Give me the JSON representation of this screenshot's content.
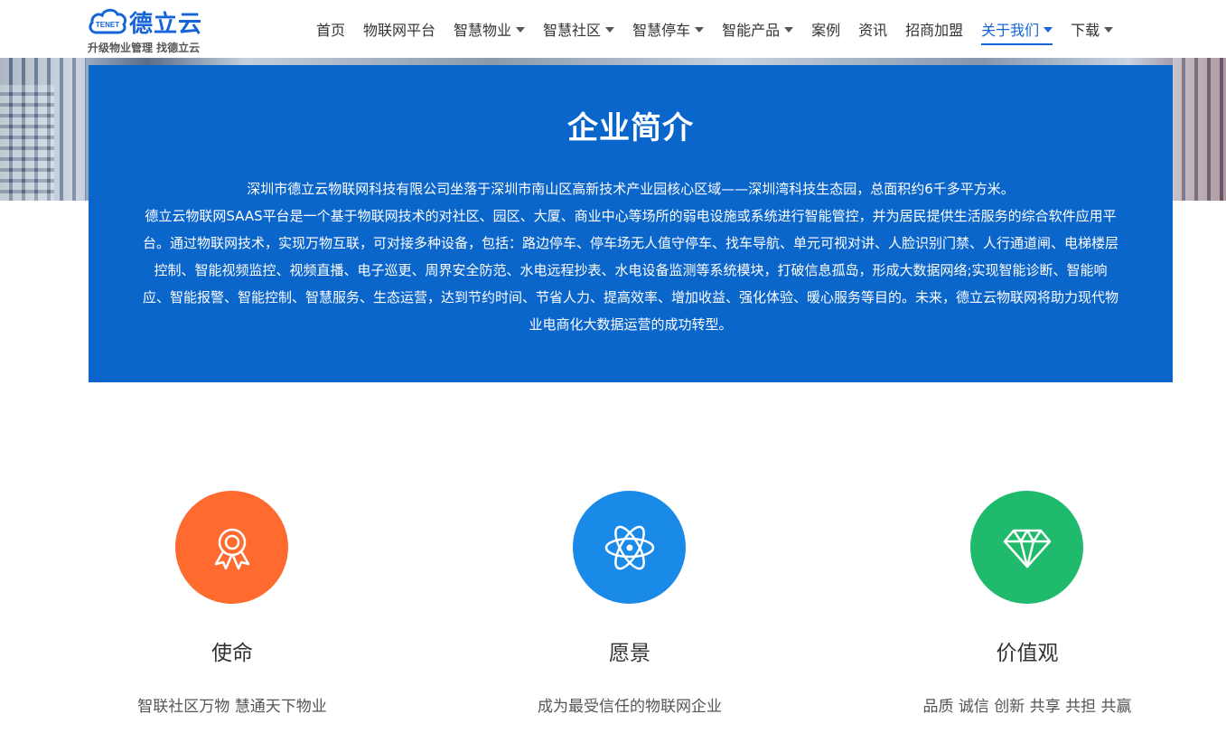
{
  "brand": {
    "name": "德立云",
    "mark_text": "TENET",
    "slogan": "升级物业管理 找德立云",
    "color": "#1565d8"
  },
  "nav": {
    "items": [
      {
        "label": "首页",
        "has_dropdown": false
      },
      {
        "label": "物联网平台",
        "has_dropdown": false
      },
      {
        "label": "智慧物业",
        "has_dropdown": true
      },
      {
        "label": "智慧社区",
        "has_dropdown": true
      },
      {
        "label": "智慧停车",
        "has_dropdown": true
      },
      {
        "label": "智能产品",
        "has_dropdown": true
      },
      {
        "label": "案例",
        "has_dropdown": false
      },
      {
        "label": "资讯",
        "has_dropdown": false
      },
      {
        "label": "招商加盟",
        "has_dropdown": false
      },
      {
        "label": "关于我们",
        "has_dropdown": true,
        "active": true
      },
      {
        "label": "下载",
        "has_dropdown": true
      }
    ]
  },
  "intro": {
    "title": "企业简介",
    "paragraph1": "深圳市德立云物联网科技有限公司坐落于深圳市南山区高新技术产业园核心区域——深圳湾科技生态园，总面积约6千多平方米。",
    "paragraph2": "德立云物联网SAAS平台是一个基于物联网技术的对社区、园区、大厦、商业中心等场所的弱电设施或系统进行智能管控，并为居民提供生活服务的综合软件应用平台。通过物联网技术，实现万物互联，可对接多种设备，包括：路边停车、停车场无人值守停车、找车导航、单元可视对讲、人脸识别门禁、人行通道闸、电梯楼层控制、智能视频监控、视频直播、电子巡更、周界安全防范、水电远程抄表、水电设备监测等系统模块，打破信息孤岛，形成大数据网络;实现智能诊断、智能响应、智能报警、智能控制、智慧服务、生态运营，达到节约时间、节省人力、提高效率、增加收益、强化体验、暖心服务等目的。未来，德立云物联网将助力现代物业电商化大数据运营的成功转型。",
    "bg_color": "#0b66cc"
  },
  "values": [
    {
      "title": "使命",
      "desc": "智联社区万物 慧通天下物业",
      "icon": "award-medal-icon",
      "color": "#ff6a2f"
    },
    {
      "title": "愿景",
      "desc": "成为最受信任的物联网企业",
      "icon": "atom-icon",
      "color": "#1a8ae8"
    },
    {
      "title": "价值观",
      "desc": "品质 诚信 创新 共享 共担 共赢",
      "icon": "diamond-icon",
      "color": "#1fba6c"
    }
  ]
}
